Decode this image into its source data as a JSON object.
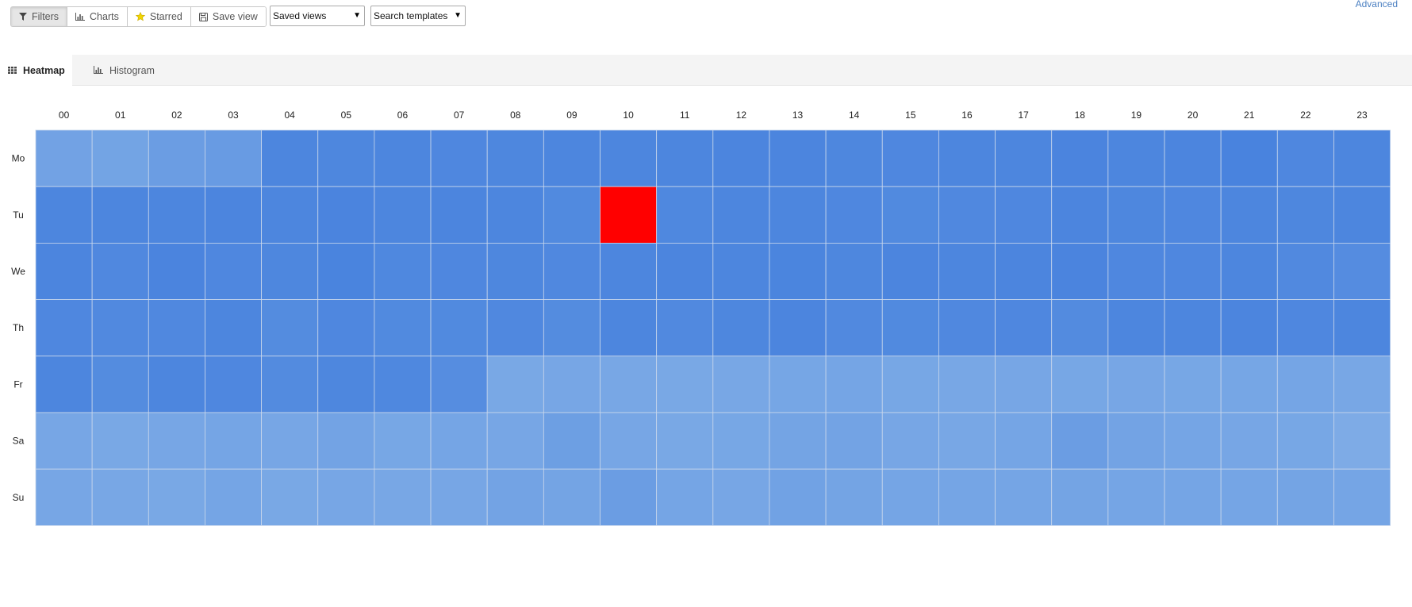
{
  "toolbar": {
    "filters_label": "Filters",
    "charts_label": "Charts",
    "starred_label": "Starred",
    "save_view_label": "Save view",
    "saved_views_value": "Saved views",
    "search_templates_value": "Search templates",
    "advanced_link": "Advanced"
  },
  "tabs": [
    {
      "label": "Heatmap",
      "icon": "grid-icon",
      "active": true
    },
    {
      "label": "Histogram",
      "icon": "bar-chart-icon",
      "active": false
    }
  ],
  "chart_data": {
    "type": "heatmap",
    "x": [
      "00",
      "01",
      "02",
      "03",
      "04",
      "05",
      "06",
      "07",
      "08",
      "09",
      "10",
      "11",
      "12",
      "13",
      "14",
      "15",
      "16",
      "17",
      "18",
      "19",
      "20",
      "21",
      "22",
      "23"
    ],
    "y": [
      "Mo",
      "Tu",
      "We",
      "Th",
      "Fr",
      "Sa",
      "Su"
    ],
    "values": [
      [
        0.35,
        0.33,
        0.45,
        0.5,
        0.88,
        0.87,
        0.88,
        0.86,
        0.87,
        0.89,
        0.88,
        0.88,
        0.9,
        0.9,
        0.87,
        0.86,
        0.89,
        0.89,
        0.92,
        0.89,
        0.9,
        0.94,
        0.86,
        0.89
      ],
      [
        0.88,
        0.89,
        0.88,
        0.9,
        0.89,
        0.92,
        0.89,
        0.9,
        0.89,
        0.82,
        1.0,
        0.85,
        0.88,
        0.89,
        0.86,
        0.82,
        0.84,
        0.86,
        0.9,
        0.87,
        0.86,
        0.89,
        0.87,
        0.88
      ],
      [
        0.9,
        0.84,
        0.92,
        0.86,
        0.87,
        0.93,
        0.85,
        0.86,
        0.87,
        0.84,
        0.88,
        0.9,
        0.89,
        0.91,
        0.87,
        0.9,
        0.88,
        0.9,
        0.92,
        0.86,
        0.86,
        0.88,
        0.83,
        0.77
      ],
      [
        0.86,
        0.83,
        0.84,
        0.88,
        0.78,
        0.86,
        0.82,
        0.82,
        0.84,
        0.78,
        0.88,
        0.83,
        0.87,
        0.9,
        0.83,
        0.82,
        0.84,
        0.86,
        0.79,
        0.88,
        0.88,
        0.9,
        0.86,
        0.88
      ],
      [
        0.88,
        0.78,
        0.88,
        0.86,
        0.8,
        0.87,
        0.85,
        0.76,
        0.25,
        0.28,
        0.26,
        0.25,
        0.26,
        0.29,
        0.3,
        0.27,
        0.26,
        0.28,
        0.27,
        0.28,
        0.27,
        0.29,
        0.3,
        0.26
      ],
      [
        0.28,
        0.24,
        0.28,
        0.3,
        0.28,
        0.34,
        0.27,
        0.3,
        0.28,
        0.42,
        0.28,
        0.24,
        0.27,
        0.32,
        0.34,
        0.28,
        0.26,
        0.3,
        0.45,
        0.34,
        0.3,
        0.28,
        0.27,
        0.18
      ],
      [
        0.28,
        0.26,
        0.24,
        0.3,
        0.25,
        0.28,
        0.26,
        0.28,
        0.34,
        0.32,
        0.45,
        0.3,
        0.28,
        0.36,
        0.32,
        0.3,
        0.3,
        0.3,
        0.32,
        0.3,
        0.3,
        0.3,
        0.32,
        0.3
      ]
    ],
    "colors": {
      "low": "#8ab5e8",
      "high": "#4580dd",
      "peak": "#ff0000",
      "grid": "#c9d7ec"
    },
    "xlabel": "",
    "ylabel": ""
  }
}
